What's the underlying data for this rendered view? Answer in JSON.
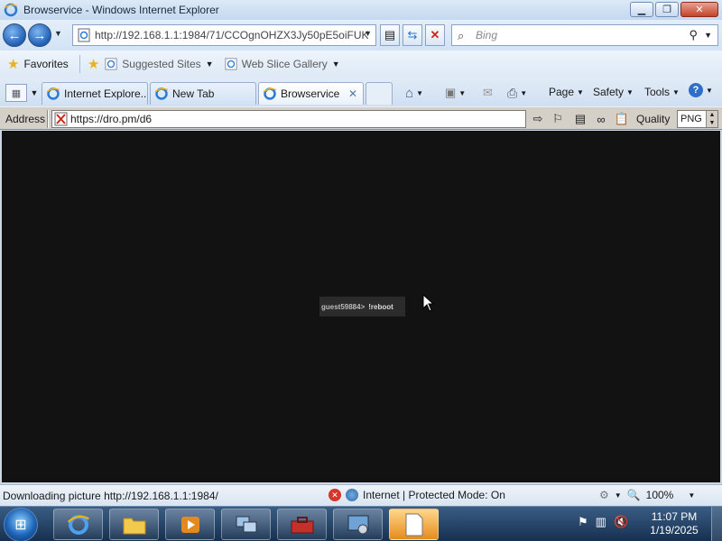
{
  "window": {
    "title": "Browservice - Windows Internet Explorer"
  },
  "nav": {
    "url": "http://192.168.1.1:1984/71/CCOgnOHZX3Jy50pE5oiFUK",
    "search_placeholder": "Bing"
  },
  "favorites_bar": {
    "favorites_label": "Favorites",
    "suggested_sites": "Suggested Sites",
    "web_slice_gallery": "Web Slice Gallery"
  },
  "tabs": [
    {
      "label": "Internet Explore...",
      "active": false
    },
    {
      "label": "New Tab",
      "active": false
    },
    {
      "label": "Browservice",
      "active": true
    }
  ],
  "command_bar": {
    "page": "Page",
    "safety": "Safety",
    "tools": "Tools"
  },
  "address_bar": {
    "label": "Address",
    "value": "https://dro.pm/d6",
    "quality_label": "Quality",
    "quality_value": "PNG"
  },
  "content": {
    "chat_user": "guest59884>",
    "chat_message": "!reboot"
  },
  "status": {
    "text": "Downloading picture http://192.168.1.1:1984/",
    "zone": "Internet | Protected Mode: On",
    "zoom": "100%"
  },
  "taskbar": {
    "time": "11:07 PM",
    "date": "1/19/2025"
  },
  "colors": {
    "content_bg": "#121212",
    "title_bg": "#c4d8ef",
    "taskbar_bg": "#16304f"
  }
}
